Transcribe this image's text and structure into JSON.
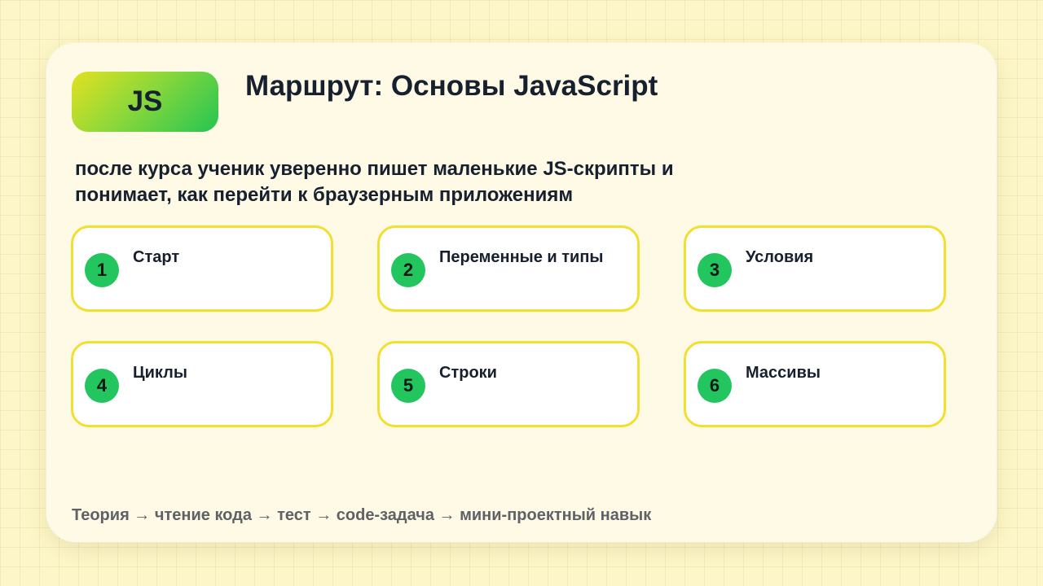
{
  "badge": {
    "label": "JS"
  },
  "header": {
    "title": "Маршрут: Основы JavaScript"
  },
  "subtitle": {
    "line1": "после курса ученик уверенно пишет маленькие JS-скрипты и",
    "line2": "понимает, как перейти к браузерным приложениям"
  },
  "steps": [
    {
      "number": "1",
      "label": "Старт"
    },
    {
      "number": "2",
      "label": "Переменные и типы"
    },
    {
      "number": "3",
      "label": "Условия"
    },
    {
      "number": "4",
      "label": "Циклы"
    },
    {
      "number": "5",
      "label": "Строки"
    },
    {
      "number": "6",
      "label": "Массивы"
    }
  ],
  "footer": {
    "text": "Теория → чтение кода → тест → code-задача → мини-проектный навык"
  },
  "colors": {
    "background": "#fdf6c8",
    "card": "#fefae6",
    "accent_green": "#22c55e",
    "accent_yellow": "#f3df2f",
    "text": "#16202e",
    "muted": "#5f6166"
  }
}
